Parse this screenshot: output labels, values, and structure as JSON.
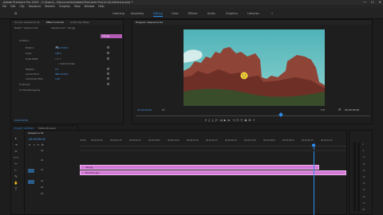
{
  "app": {
    "title": "Adobe Premiere Pro 2020 - C:\\Users\\...\\Documents\\Adobe\\Premiere Pro\\14.0\\Untitled.prproj *",
    "window_controls": [
      "—",
      "☐",
      "✕"
    ]
  },
  "menu": [
    "File",
    "Edit",
    "Clip",
    "Sequence",
    "Markers",
    "Graphics",
    "View",
    "Window",
    "Help"
  ],
  "workspaces": {
    "items": [
      "Learning",
      "Assembly",
      "Editing",
      "Color",
      "Effects",
      "Audio",
      "Graphics",
      "Libraries"
    ],
    "active_index": 2,
    "more": "»"
  },
  "source_panel": {
    "tabs": [
      "Source: Sequence 01",
      "Effect Controls",
      "Audio Clip Mixer"
    ],
    "active_tab": 1,
    "clip_header": "Master * Sequence 01",
    "clip_header2": "Sequence 01 * Cat.jpg",
    "rows": [
      "fx  Motion",
      "Position",
      "Scale",
      "Scale Width",
      "✓ Uniform Scale",
      "Rotation",
      "Anchor Point",
      "Anti-flicker Filter",
      "fx  Opacity",
      "fx  Time Remapping"
    ],
    "values": {
      "position": "960.0  540.0",
      "scale": "100.0",
      "scale_width": "100.0",
      "rotation": "0.0",
      "anchor": "960.0  540.0",
      "antiflicker": "0.00"
    },
    "mini_clip": "Cat.jpg",
    "timecode": "00:00:00:00"
  },
  "program": {
    "tab": "Program: Sequence 01",
    "timecode_left": "00:00:00:00",
    "fit": "Fit",
    "quality": "Full",
    "timecode_right": "00:00:05:00"
  },
  "transport": [
    "▾",
    "{",
    "}",
    "|←",
    "◂|",
    "▶",
    "|▸",
    "→|",
    "⎘",
    "⎗",
    "◉",
    "⊞",
    "+"
  ],
  "project": {
    "tabs": [
      "Project: Untitled",
      "Media Browser"
    ]
  },
  "timeline": {
    "tab": "Sequence 01",
    "timecode": "00:00:00:00",
    "ruler": [
      ":00:00",
      "00:00:00:20",
      "00:00:01:15",
      "00:00:02:10",
      "00:00:03:05",
      "00:00:04:00",
      "00:00:04:20",
      "00:00:05:15",
      "00:00:06:10",
      "00:00:07:05",
      "00:00:08:00",
      "00:00:08:20",
      "00:00:09:15",
      "00:00:10:10",
      "00:00:11:05"
    ],
    "video_tracks": [
      "V3",
      "V2",
      "V1"
    ],
    "audio_tracks": [
      "A1",
      "A2",
      "A3"
    ],
    "clips": [
      {
        "name": "Cat.jpg",
        "track": "V2"
      },
      {
        "name": "Mountain.jpg",
        "track": "V1"
      }
    ]
  },
  "tools": [
    "▸",
    "⇥",
    "⇔",
    "⟷",
    "✂",
    "⊢",
    "✎",
    "✋",
    "T"
  ],
  "meter_scale": [
    "0",
    "-6",
    "-12",
    "-18",
    "-24",
    "-30",
    "-36",
    "-42",
    "-48",
    "-54",
    "dB"
  ],
  "colors": {
    "accent": "#2d8ceb",
    "clip": "#d47ad6",
    "clip_dark": "#b45bb6"
  }
}
